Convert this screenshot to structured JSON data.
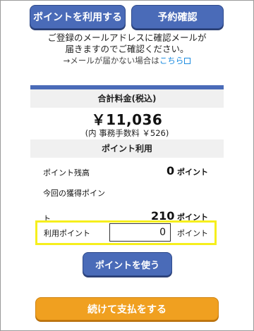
{
  "top_buttons": {
    "use_points": "ポイントを利用する",
    "reservation_check": "予約確認"
  },
  "notice": {
    "line1": "ご登録のメールアドレスに確認メールが",
    "line2": "届きますのでご確認ください。",
    "line3_prefix": "→メールが届かない場合は",
    "line3_link": "こちら"
  },
  "total": {
    "header": "合計料金(税込)",
    "amount": "￥11,036",
    "fee_note": "(内 事務手数料 ￥526)"
  },
  "points": {
    "header": "ポイント利用",
    "balance_label": "ポイント残高",
    "balance_value": "0",
    "balance_unit": "ポイント",
    "earned_label_line1": "今回の獲得ポイン",
    "earned_label_line2": "ト",
    "earned_value": "210",
    "earned_unit": "ポイント",
    "use_label": "利用ポイント",
    "use_input_value": "0",
    "use_unit": "ポイント",
    "use_button": "ポイントを使う"
  },
  "continue_button": "続けて支払をする",
  "colors": {
    "primary_button": "#4a6bb8",
    "continue_button": "#f0a020",
    "highlight": "#f6ef1c",
    "link": "#1a8be0"
  }
}
